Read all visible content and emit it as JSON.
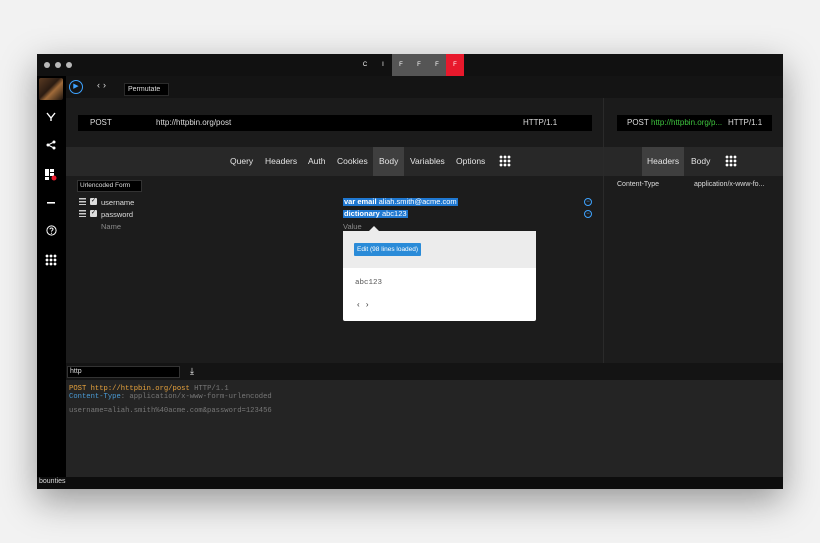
{
  "titlebar": {
    "segments": [
      "C",
      "I",
      "F",
      "F",
      "F",
      "F"
    ]
  },
  "toolbar": {
    "run_icon": "play-icon",
    "nav_back": "‹",
    "nav_forward": "›",
    "permute_label": "Permutate"
  },
  "sidebar": {
    "icons": [
      "branch-icon",
      "share-icon",
      "extensions-icon",
      "minus-icon",
      "help-icon",
      "apps-grid-icon"
    ],
    "footer_label": "bounties"
  },
  "request": {
    "method": "POST",
    "url": "http://httpbin.org/post",
    "version": "HTTP/1.1",
    "tabs": [
      "Query",
      "Headers",
      "Auth",
      "Cookies",
      "Body",
      "Variables",
      "Options"
    ],
    "active_tab": "Body",
    "body_type": "Urlencoded Form",
    "rows": [
      {
        "name": "username",
        "value_keyword": "var email",
        "value_text": "aliah.smith@acme.com"
      },
      {
        "name": "password",
        "value_keyword": "dictionary",
        "value_text": "abc123"
      }
    ],
    "name_placeholder": "Name",
    "value_placeholder": "Value"
  },
  "popup": {
    "edit_label": "Edit (98 lines loaded)",
    "value": "abc123",
    "nav": "‹ ›"
  },
  "response": {
    "method": "POST",
    "url": "http://httpbin.org/p...",
    "version": "HTTP/1.1",
    "tabs": [
      "Headers",
      "Body"
    ],
    "active_tab": "Headers",
    "header_name": "Content-Type",
    "header_value": "application/x-www-fo..."
  },
  "code": {
    "format": "http",
    "line1_method": "POST",
    "line1_url": "http://httpbin.org/post",
    "line1_version": "HTTP/1.1",
    "line2_key": "Content-Type",
    "line2_value": ": application/x-www-form-urlencoded",
    "line4": "username=aliah.smith%40acme.com&password=123456"
  },
  "colors": {
    "accent_blue": "#1f78d1",
    "url_green": "#3ec43e",
    "code_orange": "#e8a33d",
    "code_blue": "#4a9bd6",
    "active_segment": "#e8192c"
  }
}
